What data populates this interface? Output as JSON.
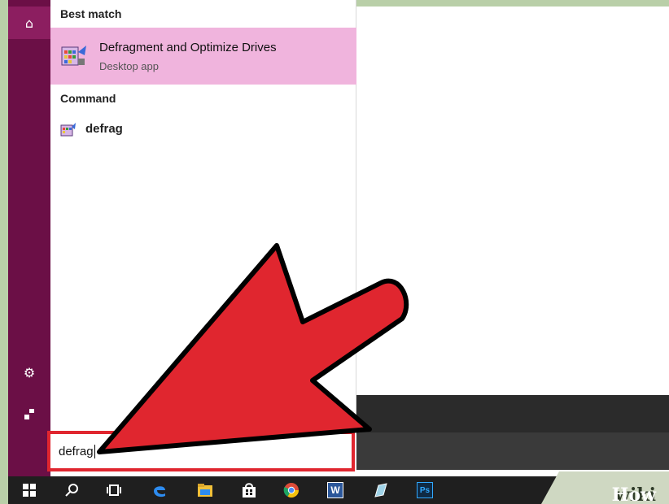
{
  "start_menu": {
    "best_match_label": "Best match",
    "best_match": {
      "title": "Defragment and Optimize Drives",
      "subtitle": "Desktop app"
    },
    "command_label": "Command",
    "command_item": {
      "label": "defrag"
    },
    "rail_icons": [
      "home-icon",
      "gear-icon",
      "user-icon"
    ]
  },
  "search": {
    "value": "defrag"
  },
  "taskbar": {
    "icons": [
      "windows-start-icon",
      "search-icon",
      "task-view-icon",
      "edge-icon",
      "file-explorer-icon",
      "store-icon",
      "chrome-icon",
      "word-icon",
      "notepad-icon",
      "photoshop-icon"
    ],
    "word_label": "W",
    "photoshop_label": "Ps"
  },
  "watermark": {
    "wiki": "wiki",
    "how": "How"
  },
  "colors": {
    "accent_rail": "#6b0f46",
    "highlight": "#f0b4dd",
    "arrow": "#e0262f"
  }
}
